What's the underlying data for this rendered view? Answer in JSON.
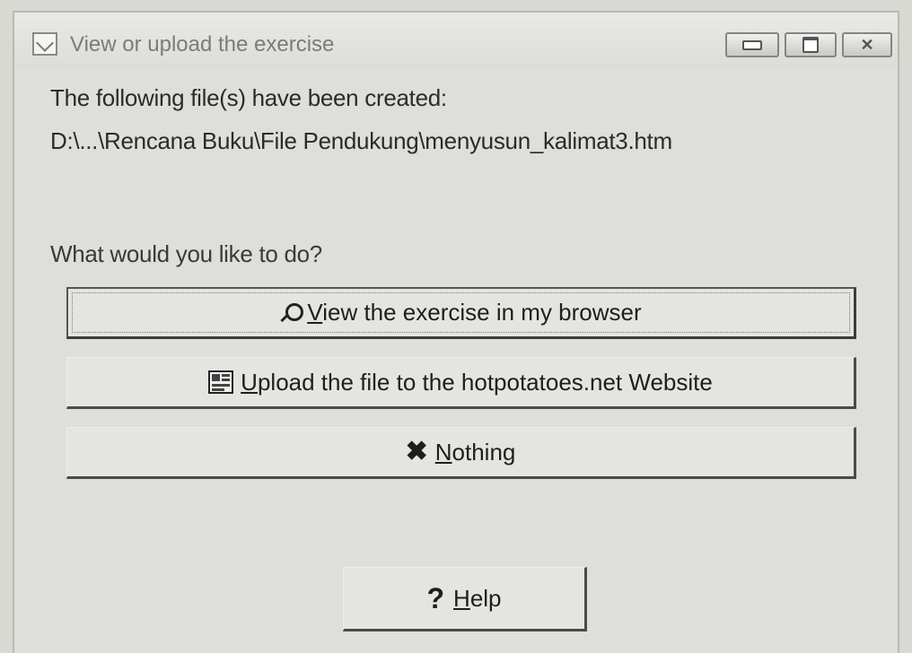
{
  "window": {
    "title": "View or upload the exercise",
    "controls": {
      "minimize": "minimize",
      "maximize": "maximize",
      "close": "close"
    }
  },
  "message": {
    "line1": "The following file(s) have been created:",
    "line2": "D:\\...\\Rencana Buku\\File Pendukung\\menyusun_kalimat3.htm",
    "question": "What would you like to do?"
  },
  "buttons": {
    "view": {
      "accel": "V",
      "rest": "iew the exercise in my browser",
      "icon": "search-icon"
    },
    "upload": {
      "accel": "U",
      "rest": "pload the file to the hotpotatoes.net Website",
      "icon": "upload-icon"
    },
    "nothing": {
      "accel": "N",
      "rest": "othing",
      "icon": "close-x-icon"
    },
    "help": {
      "accel": "H",
      "rest": "elp",
      "icon": "question-mark-icon"
    }
  }
}
